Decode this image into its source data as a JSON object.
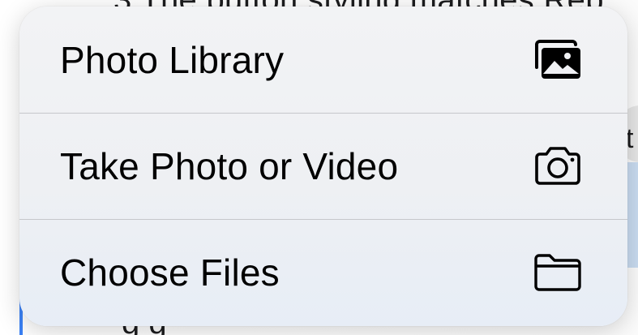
{
  "background": {
    "top_text": "3   The button styling matches Rep",
    "bottom_text": "g g",
    "right_text": "t"
  },
  "menu": {
    "items": [
      {
        "label": "Photo Library",
        "icon": "photo-library-icon"
      },
      {
        "label": "Take Photo or Video",
        "icon": "camera-icon"
      },
      {
        "label": "Choose Files",
        "icon": "folder-icon"
      }
    ]
  },
  "colors": {
    "menu_background": "#f0f1f4",
    "separator": "#c6c7cb",
    "text": "#000000"
  }
}
